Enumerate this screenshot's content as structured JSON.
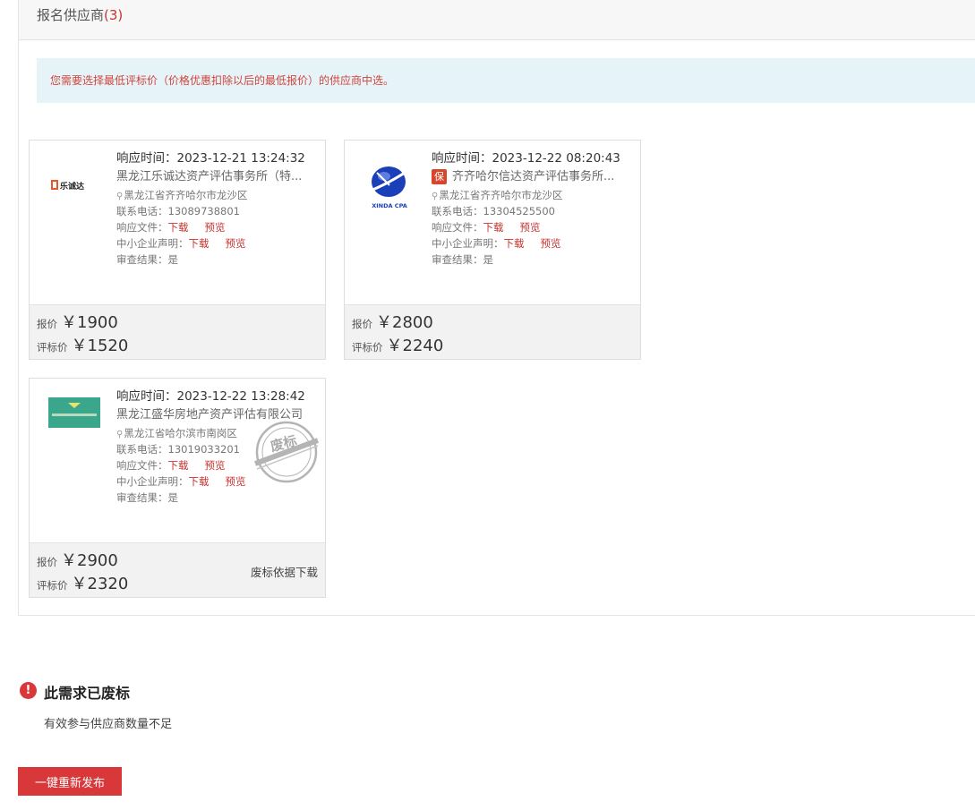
{
  "section": {
    "title": "报名供应商",
    "count": "(3)"
  },
  "notice": "您需要选择最低评标价（价格优惠扣除以后的最低报价）的供应商中选。",
  "labels": {
    "resp_time": "响应时间：",
    "phone": "联系电话：",
    "resp_file": "响应文件：",
    "sme": "中小企业声明：",
    "review": "审查结果：",
    "download": "下载",
    "preview": "预览",
    "price": "报价",
    "eval_price": "评标价"
  },
  "suppliers": [
    {
      "time": "2023-12-21 13:24:32",
      "company": "黑龙江乐诚达资产评估事务所（特...",
      "address": "黑龙江省齐齐哈尔市龙沙区",
      "phone": "13089738801",
      "review": "是",
      "price": "￥1900",
      "eval_price": "￥1520",
      "logo_text": "乐诚达"
    },
    {
      "time": "2023-12-22 08:20:43",
      "badge": "保",
      "company": "齐齐哈尔信达资产评估事务所...",
      "address": "黑龙江省齐齐哈尔市龙沙区",
      "phone": "13304525500",
      "review": "是",
      "price": "￥2800",
      "eval_price": "￥2240",
      "logo_text": "XINDA CPA"
    },
    {
      "time": "2023-12-22 13:28:42",
      "company": "黑龙江盛华房地产资产评估有限公司",
      "address": "黑龙江省哈尔滨市南岗区",
      "phone": "13019033201",
      "review": "是",
      "price": "￥2900",
      "eval_price": "￥2320",
      "stamp": "废标",
      "waste_link": "废标依据下载"
    }
  ],
  "status": {
    "title": "此需求已废标",
    "desc": "有效参与供应商数量不足"
  },
  "republish_label": "一键重新发布",
  "colors": {
    "accent": "#d9383a",
    "link": "#c8332e",
    "notice_bg": "#e6f4fa"
  }
}
